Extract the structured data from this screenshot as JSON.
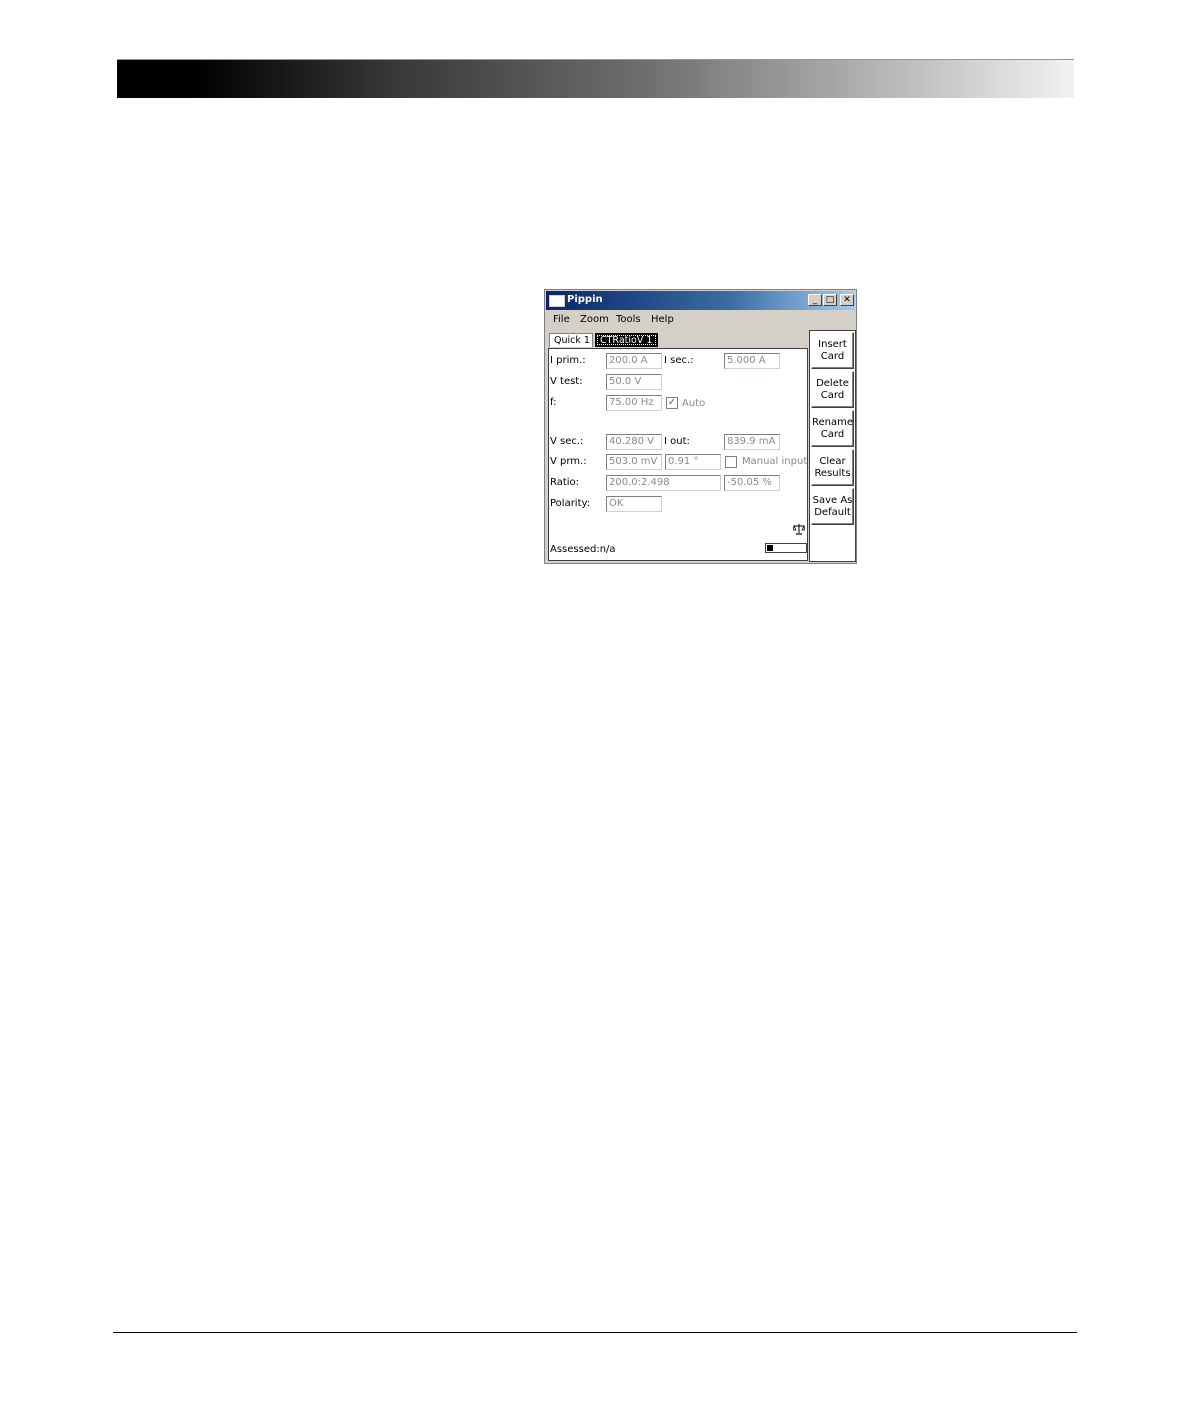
{
  "window": {
    "title": "Pippin",
    "controls": {
      "minimize": "_",
      "maximize": "□",
      "close": "✕"
    }
  },
  "menu": [
    "File",
    "Zoom",
    "Tools",
    "Help"
  ],
  "tabs": [
    {
      "label": "Quick 1",
      "active": false
    },
    {
      "label": "CTRatioV 1",
      "active": true
    }
  ],
  "form": {
    "i_prim": {
      "label": "I prim.:",
      "value": "200.0 A"
    },
    "i_sec": {
      "label": "I sec.:",
      "value": "5.000 A"
    },
    "v_test": {
      "label": "V test:",
      "value": "50.0 V"
    },
    "f": {
      "label": "f:",
      "value": "75.00 Hz"
    },
    "auto": {
      "label": "Auto",
      "checked": true
    },
    "v_sec": {
      "label": "V sec.:",
      "value": "40.280 V"
    },
    "i_out": {
      "label": "I out:",
      "value": "839.9 mA"
    },
    "v_prm": {
      "label": "V prm.:",
      "value": "503.0 mV",
      "phase": "0.91 °"
    },
    "manual_input": {
      "label": "Manual input",
      "checked": false
    },
    "ratio": {
      "label": "Ratio:",
      "value": "200.0:2.498",
      "deviation": "-50.05 %"
    },
    "polarity": {
      "label": "Polarity:",
      "value": "OK"
    }
  },
  "status": {
    "assessed": "Assessed:n/a",
    "progress": 0.15
  },
  "sidebar": {
    "buttons": [
      {
        "label": "Insert\nCard"
      },
      {
        "label": "Delete\nCard"
      },
      {
        "label": "Rename\nCard"
      },
      {
        "label": "Clear\nResults"
      },
      {
        "label": "Save As\nDefault"
      }
    ]
  }
}
